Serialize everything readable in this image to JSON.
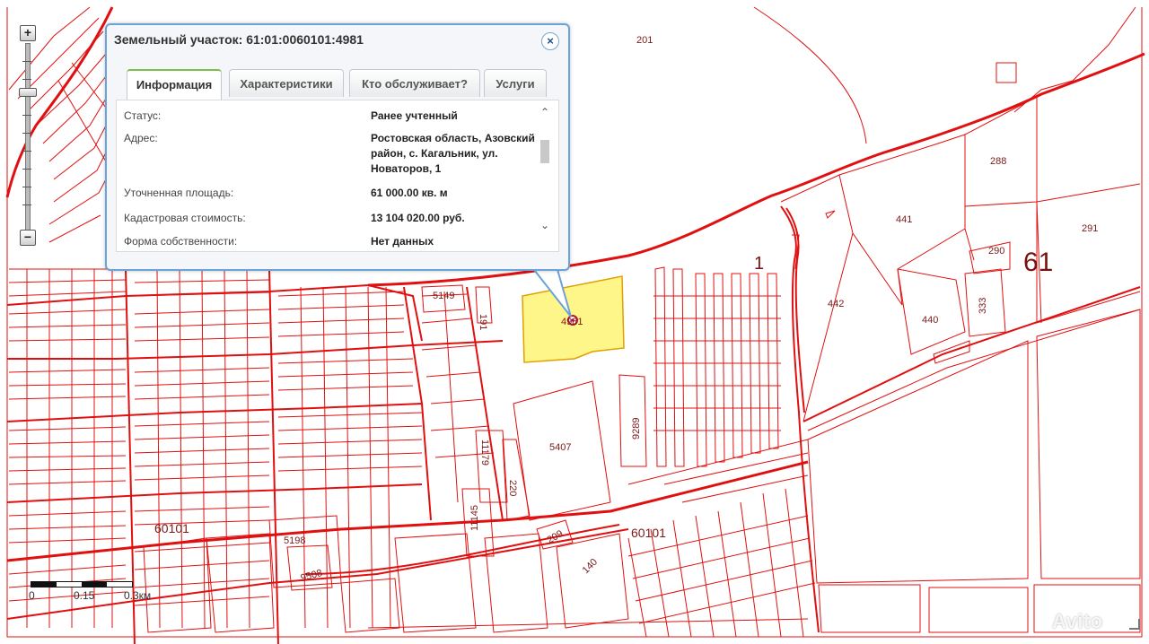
{
  "map": {
    "parcel_labels": [
      {
        "id": "p201",
        "text": "201"
      },
      {
        "id": "p288",
        "text": "288"
      },
      {
        "id": "p291",
        "text": "291"
      },
      {
        "id": "p441",
        "text": "441"
      },
      {
        "id": "p442",
        "text": "442"
      },
      {
        "id": "p440",
        "text": "440"
      },
      {
        "id": "p290",
        "text": "290"
      },
      {
        "id": "p333",
        "text": "333"
      },
      {
        "id": "p5149",
        "text": "5149"
      },
      {
        "id": "p191",
        "text": "191"
      },
      {
        "id": "p4981",
        "text": "4981"
      },
      {
        "id": "p5407",
        "text": "5407"
      },
      {
        "id": "p9289",
        "text": "9289"
      },
      {
        "id": "p11179",
        "text": "11179"
      },
      {
        "id": "p220",
        "text": "220"
      },
      {
        "id": "p11145",
        "text": "11145"
      },
      {
        "id": "p209",
        "text": "209"
      },
      {
        "id": "p5198",
        "text": "5198"
      },
      {
        "id": "p9508",
        "text": "9508"
      },
      {
        "id": "p140",
        "text": "140"
      }
    ],
    "block_labels": {
      "west": "60101",
      "east": "60101"
    },
    "district_label": "61",
    "region_label": "1",
    "highlight_color": "#fff68a",
    "parcel_stroke_color": "#e01010"
  },
  "zoom": {
    "plus": "+",
    "minus": "−"
  },
  "popup": {
    "title": "Земельный участок: 61:01:0060101:4981",
    "close_icon": "×",
    "tabs": [
      {
        "label": "Информация",
        "active": true
      },
      {
        "label": "Характеристики",
        "active": false
      },
      {
        "label": "Кто обслуживает?",
        "active": false
      },
      {
        "label": "Услуги",
        "active": false
      }
    ],
    "rows": [
      {
        "label": "Статус:",
        "value": "Ранее учтенный"
      },
      {
        "label": "Адрес:",
        "value": "Ростовская область, Азовский район, с. Кагальник, ул. Новаторов, 1"
      },
      {
        "label": "Уточненная площадь:",
        "value": "61 000.00 кв. м"
      },
      {
        "label": "Кадастровая стоимость:",
        "value": "13 104 020.00 руб."
      },
      {
        "label": "Форма собственности:",
        "value": "Нет данных"
      }
    ],
    "scroll_up_icon": "⌃",
    "scroll_down_icon": "⌄"
  },
  "scale": {
    "labels": [
      "0",
      "0.15",
      "0.3км"
    ]
  },
  "watermark": "Avito"
}
